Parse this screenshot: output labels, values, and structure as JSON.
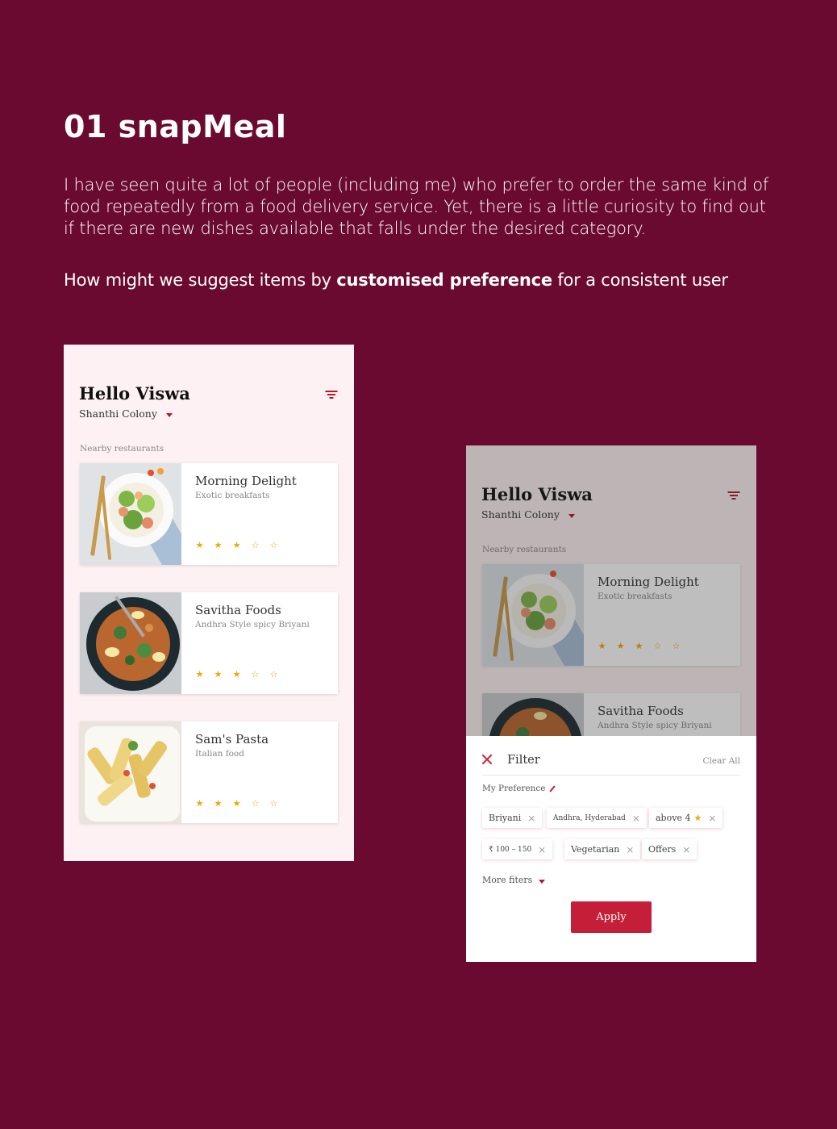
{
  "heading": {
    "title": "01 snapMeal",
    "intro": "I have seen quite a lot of people (including me) who prefer to order the same kind of food repeatedly from a food delivery service. Yet, there is a little curiosity to find out if there are new dishes available that falls under the desired category.",
    "hmw_prefix": "How might we suggest items by ",
    "hmw_bold": "customised preference",
    "hmw_suffix": " for a consistent user"
  },
  "app": {
    "greeting": "Hello Viswa",
    "location": "Shanthi Colony",
    "section_label": "Nearby restaurants",
    "restaurants": [
      {
        "name": "Morning Delight",
        "desc": "Exotic breakfasts",
        "rating": 3,
        "image_icon": "salad-plate-image"
      },
      {
        "name": "Savitha Foods",
        "desc": "Andhra Style spicy Briyani",
        "rating": 3,
        "image_icon": "biryani-pan-image"
      },
      {
        "name": "Sam's Pasta",
        "desc": "Italian food",
        "rating": 3,
        "image_icon": "pasta-bowl-image"
      }
    ],
    "star_filled": "★",
    "star_empty": "☆",
    "accent_color": "#c41e38"
  },
  "filter": {
    "title": "Filter",
    "clear_all": "Clear All",
    "my_preference": "My Preference",
    "chips_row1": [
      "Briyani",
      "Andhra, Hyderabad",
      "above 4"
    ],
    "chips_row2": [
      "₹ 100 – 150",
      "Vegetarian",
      "Offers"
    ],
    "chip_remove": "×",
    "more_filters": "More fiters",
    "apply": "Apply"
  }
}
